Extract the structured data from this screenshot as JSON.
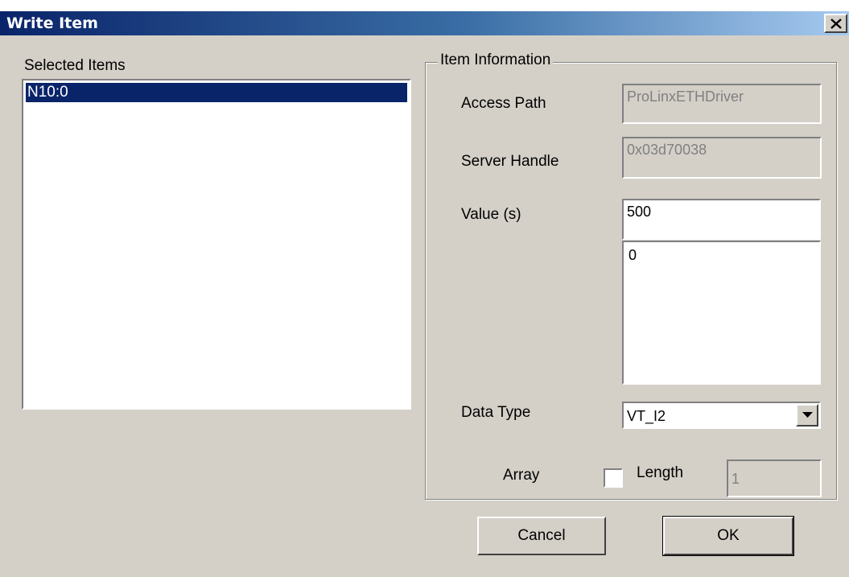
{
  "window": {
    "title": "Write Item"
  },
  "selected_items": {
    "label": "Selected Items",
    "items": [
      "N10:0"
    ],
    "selected_index": 0
  },
  "item_information": {
    "group_label": "Item Information",
    "access_path": {
      "label": "Access Path",
      "value": "ProLinxETHDriver",
      "enabled": false
    },
    "server_handle": {
      "label": "Server Handle",
      "value": "0x03d70038",
      "enabled": false
    },
    "values": {
      "label": "Value (s)",
      "value": "500",
      "list": [
        "0"
      ]
    },
    "data_type": {
      "label": "Data Type",
      "selected": "VT_I2"
    },
    "array": {
      "label": "Array",
      "checked": false
    },
    "length": {
      "label": "Length",
      "value": "1",
      "enabled": false
    }
  },
  "buttons": {
    "cancel": "Cancel",
    "ok": "OK"
  },
  "colors": {
    "dialog_bg": "#d4d0c8",
    "titlebar_start": "#0a246a",
    "titlebar_end": "#a6caf0",
    "selection": "#0a246a"
  },
  "icons": {
    "close": "close-icon",
    "dropdown": "chevron-down-icon"
  }
}
